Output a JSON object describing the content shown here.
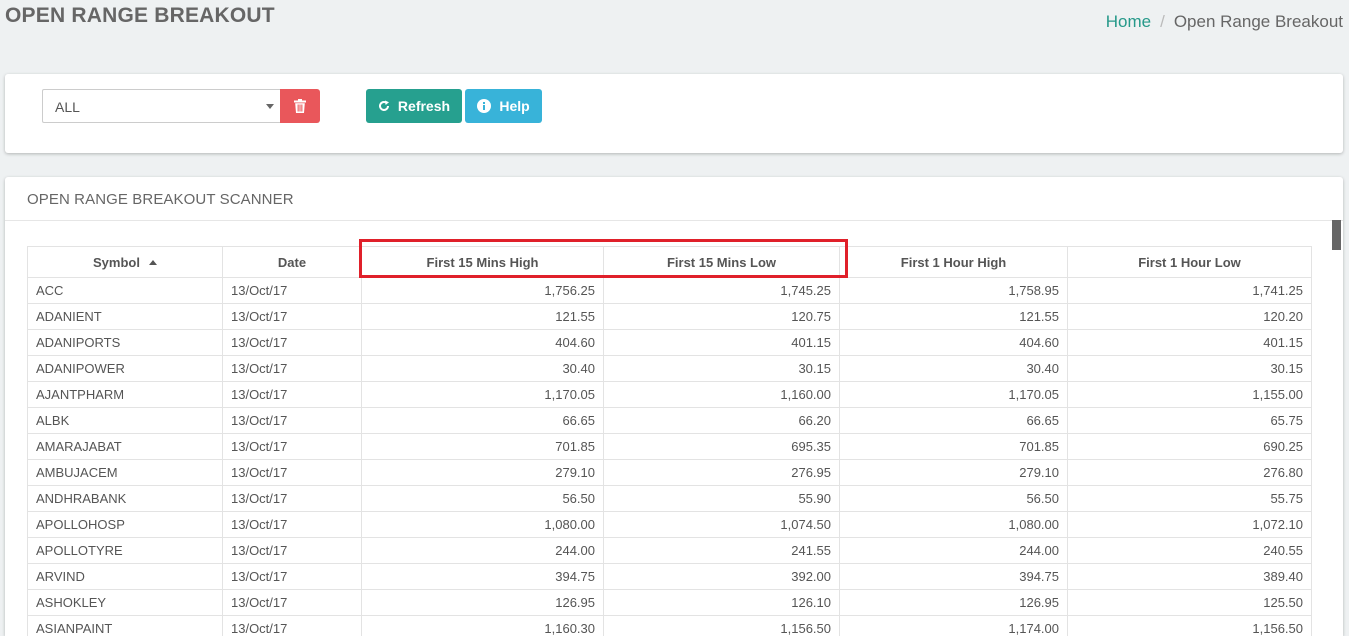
{
  "page": {
    "title": "OPEN RANGE BREAKOUT",
    "breadcrumb": {
      "home": "Home",
      "separator": "/",
      "current": "Open Range Breakout"
    }
  },
  "filter": {
    "selected": "ALL",
    "refresh_label": "Refresh",
    "help_label": "Help"
  },
  "scanner": {
    "title": "OPEN RANGE BREAKOUT SCANNER",
    "columns": [
      "Symbol",
      "Date",
      "First 15 Mins High",
      "First 15 Mins Low",
      "First 1 Hour High",
      "First 1 Hour Low"
    ],
    "rows": [
      [
        "ACC",
        "13/Oct/17",
        "1,756.25",
        "1,745.25",
        "1,758.95",
        "1,741.25"
      ],
      [
        "ADANIENT",
        "13/Oct/17",
        "121.55",
        "120.75",
        "121.55",
        "120.20"
      ],
      [
        "ADANIPORTS",
        "13/Oct/17",
        "404.60",
        "401.15",
        "404.60",
        "401.15"
      ],
      [
        "ADANIPOWER",
        "13/Oct/17",
        "30.40",
        "30.15",
        "30.40",
        "30.15"
      ],
      [
        "AJANTPHARM",
        "13/Oct/17",
        "1,170.05",
        "1,160.00",
        "1,170.05",
        "1,155.00"
      ],
      [
        "ALBK",
        "13/Oct/17",
        "66.65",
        "66.20",
        "66.65",
        "65.75"
      ],
      [
        "AMARAJABAT",
        "13/Oct/17",
        "701.85",
        "695.35",
        "701.85",
        "690.25"
      ],
      [
        "AMBUJACEM",
        "13/Oct/17",
        "279.10",
        "276.95",
        "279.10",
        "276.80"
      ],
      [
        "ANDHRABANK",
        "13/Oct/17",
        "56.50",
        "55.90",
        "56.50",
        "55.75"
      ],
      [
        "APOLLOHOSP",
        "13/Oct/17",
        "1,080.00",
        "1,074.50",
        "1,080.00",
        "1,072.10"
      ],
      [
        "APOLLOTYRE",
        "13/Oct/17",
        "244.00",
        "241.55",
        "244.00",
        "240.55"
      ],
      [
        "ARVIND",
        "13/Oct/17",
        "394.75",
        "392.00",
        "394.75",
        "389.40"
      ],
      [
        "ASHOKLEY",
        "13/Oct/17",
        "126.95",
        "126.10",
        "126.95",
        "125.50"
      ],
      [
        "ASIANPAINT",
        "13/Oct/17",
        "1,160.30",
        "1,156.50",
        "1,174.00",
        "1,156.50"
      ]
    ]
  },
  "colors": {
    "accent": "#26998a",
    "refresh": "#26a08f",
    "help": "#38b3d9",
    "delete": "#e9575b",
    "highlight": "#e0202a"
  },
  "icons": {
    "delete": "trash-icon",
    "refresh": "refresh-icon",
    "help": "info-icon",
    "sort": "sort-up-icon",
    "dropdown": "caret-down-icon"
  }
}
